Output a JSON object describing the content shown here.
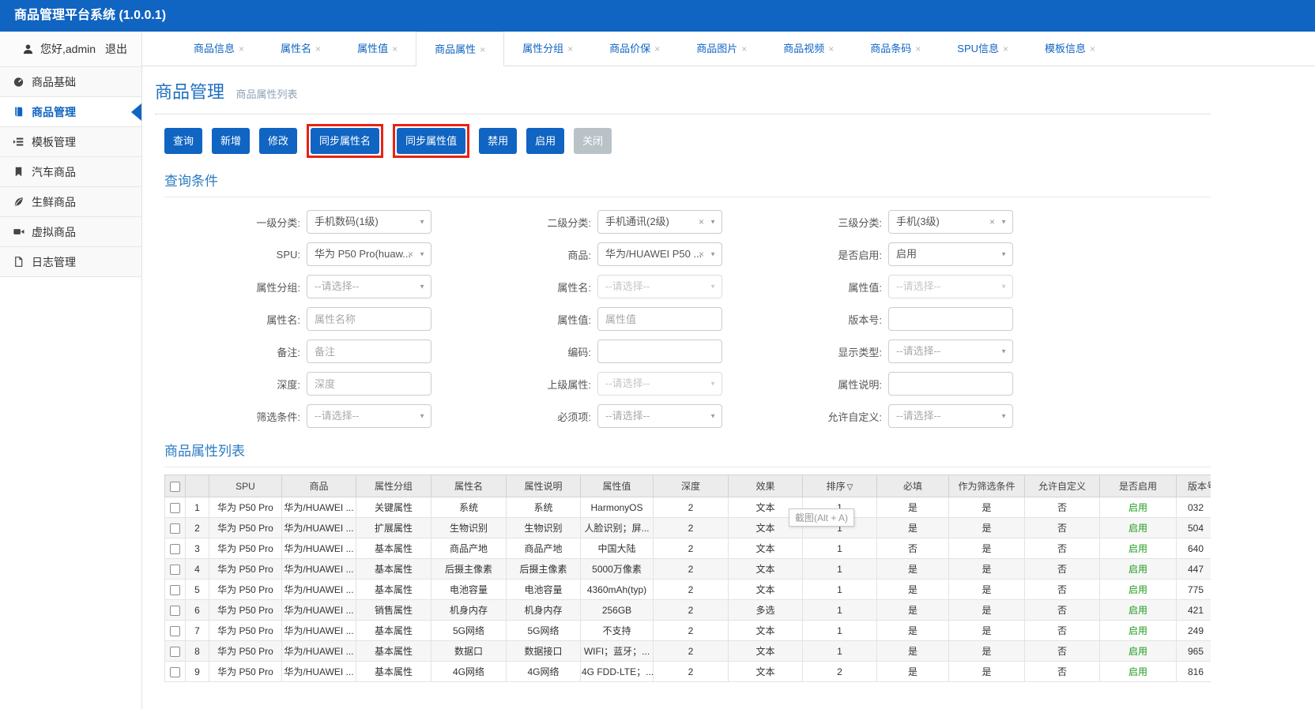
{
  "topbar": {
    "title": "商品管理平台系统 (1.0.0.1)"
  },
  "sidebar": {
    "user": {
      "greeting": "您好,admin",
      "logout": "退出"
    },
    "items": [
      {
        "label": "商品基础",
        "icon": "dashboard-icon",
        "active": false
      },
      {
        "label": "商品管理",
        "icon": "book-icon",
        "active": true
      },
      {
        "label": "模板管理",
        "icon": "template-icon",
        "active": false
      },
      {
        "label": "汽车商品",
        "icon": "bookmark-icon",
        "active": false
      },
      {
        "label": "生鲜商品",
        "icon": "leaf-icon",
        "active": false
      },
      {
        "label": "虚拟商品",
        "icon": "video-icon",
        "active": false
      },
      {
        "label": "日志管理",
        "icon": "file-icon",
        "active": false
      }
    ]
  },
  "tabs": [
    {
      "label": "商品信息",
      "active": false
    },
    {
      "label": "属性名",
      "active": false
    },
    {
      "label": "属性值",
      "active": false
    },
    {
      "label": "商品属性",
      "active": true
    },
    {
      "label": "属性分组",
      "active": false
    },
    {
      "label": "商品价保",
      "active": false
    },
    {
      "label": "商品图片",
      "active": false
    },
    {
      "label": "商品视频",
      "active": false
    },
    {
      "label": "商品条码",
      "active": false
    },
    {
      "label": "SPU信息",
      "active": false
    },
    {
      "label": "模板信息",
      "active": false
    }
  ],
  "icons": {
    "tab_close": "×",
    "select_caret": "▼",
    "clear": "×",
    "sort_desc": "▽"
  },
  "page": {
    "title": "商品管理",
    "subtitle": "商品属性列表"
  },
  "toolbar": {
    "buttons": [
      {
        "label": "查询"
      },
      {
        "label": "新增"
      },
      {
        "label": "修改"
      },
      {
        "label": "同步属性名",
        "highlighted": true
      },
      {
        "label": "同步属性值",
        "highlighted": true
      },
      {
        "label": "禁用"
      },
      {
        "label": "启用"
      },
      {
        "label": "关闭",
        "variant": "gray"
      }
    ]
  },
  "query_section": {
    "title": "查询条件",
    "rows": [
      [
        {
          "label": "一级分类:",
          "type": "select",
          "value": "手机数码(1级)"
        },
        {
          "label": "二级分类:",
          "type": "select",
          "value": "手机通讯(2级)",
          "clearable": true
        },
        {
          "label": "三级分类:",
          "type": "select",
          "value": "手机(3级)",
          "clearable": true
        }
      ],
      [
        {
          "label": "SPU:",
          "type": "select",
          "value": "华为 P50 Pro(huaw...",
          "clearable": true
        },
        {
          "label": "商品:",
          "type": "select",
          "value": "华为/HUAWEI P50 ...",
          "clearable": true
        },
        {
          "label": "是否启用:",
          "type": "select",
          "value": "启用"
        }
      ],
      [
        {
          "label": "属性分组:",
          "type": "select",
          "placeholder": "--请选择--"
        },
        {
          "label": "属性名:",
          "type": "select",
          "placeholder": "--请选择--",
          "disabled": true
        },
        {
          "label": "属性值:",
          "type": "select",
          "placeholder": "--请选择--",
          "disabled": true
        }
      ],
      [
        {
          "label": "属性名:",
          "type": "input",
          "placeholder": "属性名称",
          "value": ""
        },
        {
          "label": "属性值:",
          "type": "input",
          "placeholder": "属性值",
          "value": ""
        },
        {
          "label": "版本号:",
          "type": "input",
          "placeholder": "",
          "value": ""
        }
      ],
      [
        {
          "label": "备注:",
          "type": "input",
          "placeholder": "备注",
          "value": ""
        },
        {
          "label": "编码:",
          "type": "input",
          "placeholder": "",
          "value": ""
        },
        {
          "label": "显示类型:",
          "type": "select",
          "placeholder": "--请选择--"
        }
      ],
      [
        {
          "label": "深度:",
          "type": "input",
          "placeholder": "深度",
          "value": ""
        },
        {
          "label": "上级属性:",
          "type": "select",
          "placeholder": "--请选择--",
          "disabled": true
        },
        {
          "label": "属性说明:",
          "type": "input",
          "placeholder": "",
          "value": ""
        }
      ],
      [
        {
          "label": "筛选条件:",
          "type": "select",
          "placeholder": "--请选择--"
        },
        {
          "label": "必须项:",
          "type": "select",
          "placeholder": "--请选择--"
        },
        {
          "label": "允许自定义:",
          "type": "select",
          "placeholder": "--请选择--"
        }
      ]
    ]
  },
  "list_section": {
    "title": "商品属性列表",
    "columns": [
      "SPU",
      "商品",
      "属性分组",
      "属性名",
      "属性说明",
      "属性值",
      "深度",
      "效果",
      "排序",
      "必填",
      "作为筛选条件",
      "允许自定义",
      "是否启用",
      "版本号"
    ],
    "sort_column_index": 8,
    "rows": [
      [
        "1",
        "华为 P50 Pro",
        "华为/HUAWEI ...",
        "关键属性",
        "系统",
        "系统",
        "HarmonyOS",
        "2",
        "文本",
        "1",
        "是",
        "是",
        "否",
        "启用",
        "032"
      ],
      [
        "2",
        "华为 P50 Pro",
        "华为/HUAWEI ...",
        "扩展属性",
        "生物识别",
        "生物识别",
        "人脸识别；屏...",
        "2",
        "文本",
        "1",
        "是",
        "是",
        "否",
        "启用",
        "504"
      ],
      [
        "3",
        "华为 P50 Pro",
        "华为/HUAWEI ...",
        "基本属性",
        "商品产地",
        "商品产地",
        "中国大陆",
        "2",
        "文本",
        "1",
        "否",
        "是",
        "否",
        "启用",
        "640"
      ],
      [
        "4",
        "华为 P50 Pro",
        "华为/HUAWEI ...",
        "基本属性",
        "后摄主像素",
        "后摄主像素",
        "5000万像素",
        "2",
        "文本",
        "1",
        "是",
        "是",
        "否",
        "启用",
        "447"
      ],
      [
        "5",
        "华为 P50 Pro",
        "华为/HUAWEI ...",
        "基本属性",
        "电池容量",
        "电池容量",
        "4360mAh(typ)",
        "2",
        "文本",
        "1",
        "是",
        "是",
        "否",
        "启用",
        "775"
      ],
      [
        "6",
        "华为 P50 Pro",
        "华为/HUAWEI ...",
        "销售属性",
        "机身内存",
        "机身内存",
        "256GB",
        "2",
        "多选",
        "1",
        "是",
        "是",
        "否",
        "启用",
        "421"
      ],
      [
        "7",
        "华为 P50 Pro",
        "华为/HUAWEI ...",
        "基本属性",
        "5G网络",
        "5G网络",
        "不支持",
        "2",
        "文本",
        "1",
        "是",
        "是",
        "否",
        "启用",
        "249"
      ],
      [
        "8",
        "华为 P50 Pro",
        "华为/HUAWEI ...",
        "基本属性",
        "数据口",
        "数据接口",
        "WIFI；蓝牙；...",
        "2",
        "文本",
        "1",
        "是",
        "是",
        "否",
        "启用",
        "965"
      ],
      [
        "9",
        "华为 P50 Pro",
        "华为/HUAWEI ...",
        "基本属性",
        "4G网络",
        "4G网络",
        "4G FDD-LTE；...",
        "2",
        "文本",
        "2",
        "是",
        "是",
        "否",
        "启用",
        "816"
      ]
    ]
  },
  "tooltip": {
    "text": "截图(Alt + A)"
  },
  "colors": {
    "primary": "#1064c2",
    "highlight_red": "#ea2113",
    "enabled_green": "#1f9c1f"
  }
}
